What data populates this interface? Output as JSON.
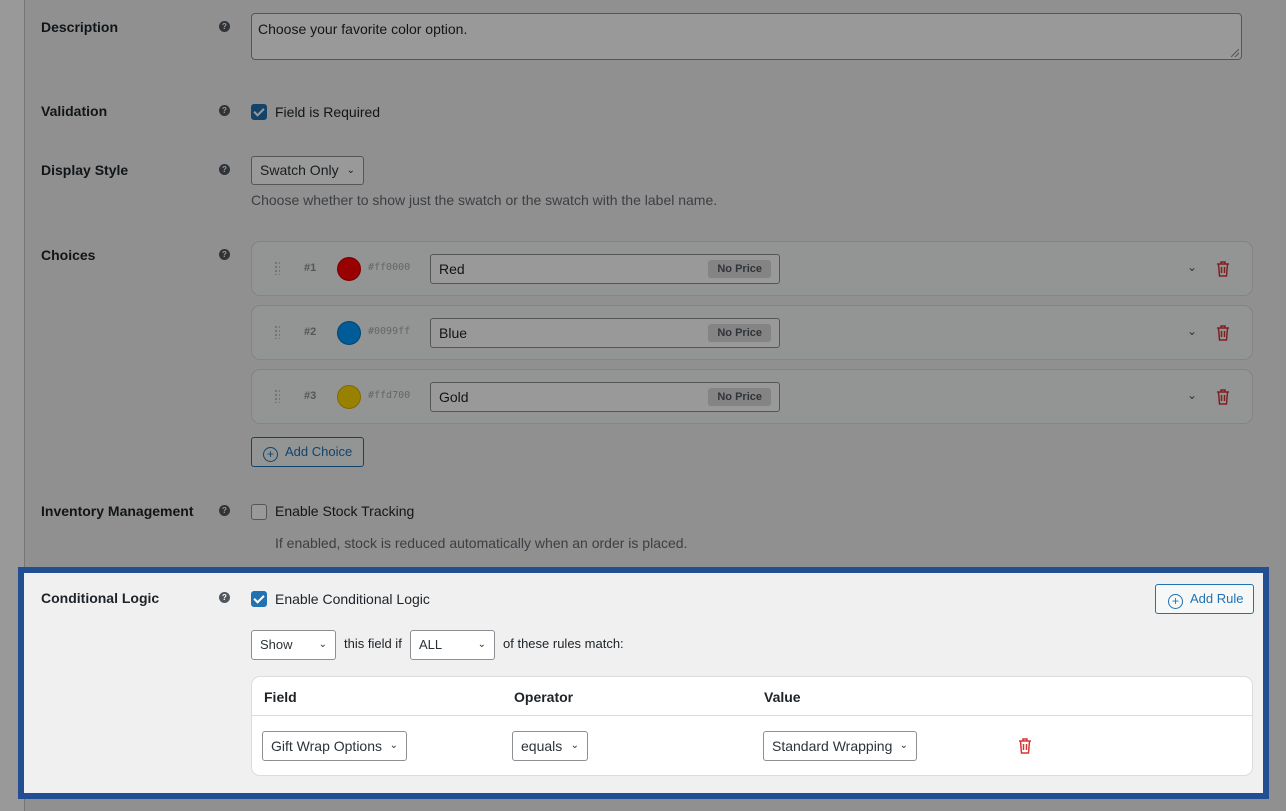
{
  "rows": {
    "description": {
      "label": "Description",
      "value": "Choose your favorite color option."
    },
    "validation": {
      "label": "Validation",
      "checkbox_label": "Field is Required"
    },
    "display_style": {
      "label": "Display Style",
      "selected": "Swatch Only",
      "help": "Choose whether to show just the swatch or the swatch with the label name."
    },
    "choices": {
      "label": "Choices",
      "items": [
        {
          "num": "#1",
          "hex": "#ff0000",
          "name": "Red",
          "price": "No Price"
        },
        {
          "num": "#2",
          "hex": "#0099ff",
          "name": "Blue",
          "price": "No Price"
        },
        {
          "num": "#3",
          "hex": "#ffd700",
          "name": "Gold",
          "price": "No Price"
        }
      ],
      "add_label": "Add Choice"
    },
    "inventory": {
      "label": "Inventory Management",
      "checkbox_label": "Enable Stock Tracking",
      "help": "If enabled, stock is reduced automatically when an order is placed."
    },
    "conditional": {
      "label": "Conditional Logic",
      "checkbox_label": "Enable Conditional Logic",
      "add_rule_label": "Add Rule",
      "action": "Show",
      "text_mid": "this field if",
      "match": "ALL",
      "text_end": "of these rules match:",
      "headers": {
        "field": "Field",
        "operator": "Operator",
        "value": "Value"
      },
      "rule": {
        "field": "Gift Wrap Options",
        "operator": "equals",
        "value": "Standard Wrapping"
      }
    }
  },
  "colors": {
    "highlight": "#3b82f6",
    "accent": "#2271b1",
    "danger": "#d63638"
  },
  "icons": {
    "help": "question-circle-icon",
    "delete": "trash-icon",
    "add": "plus-circle-icon",
    "expand": "chevron-down-icon",
    "drag": "drag-handle-icon"
  }
}
